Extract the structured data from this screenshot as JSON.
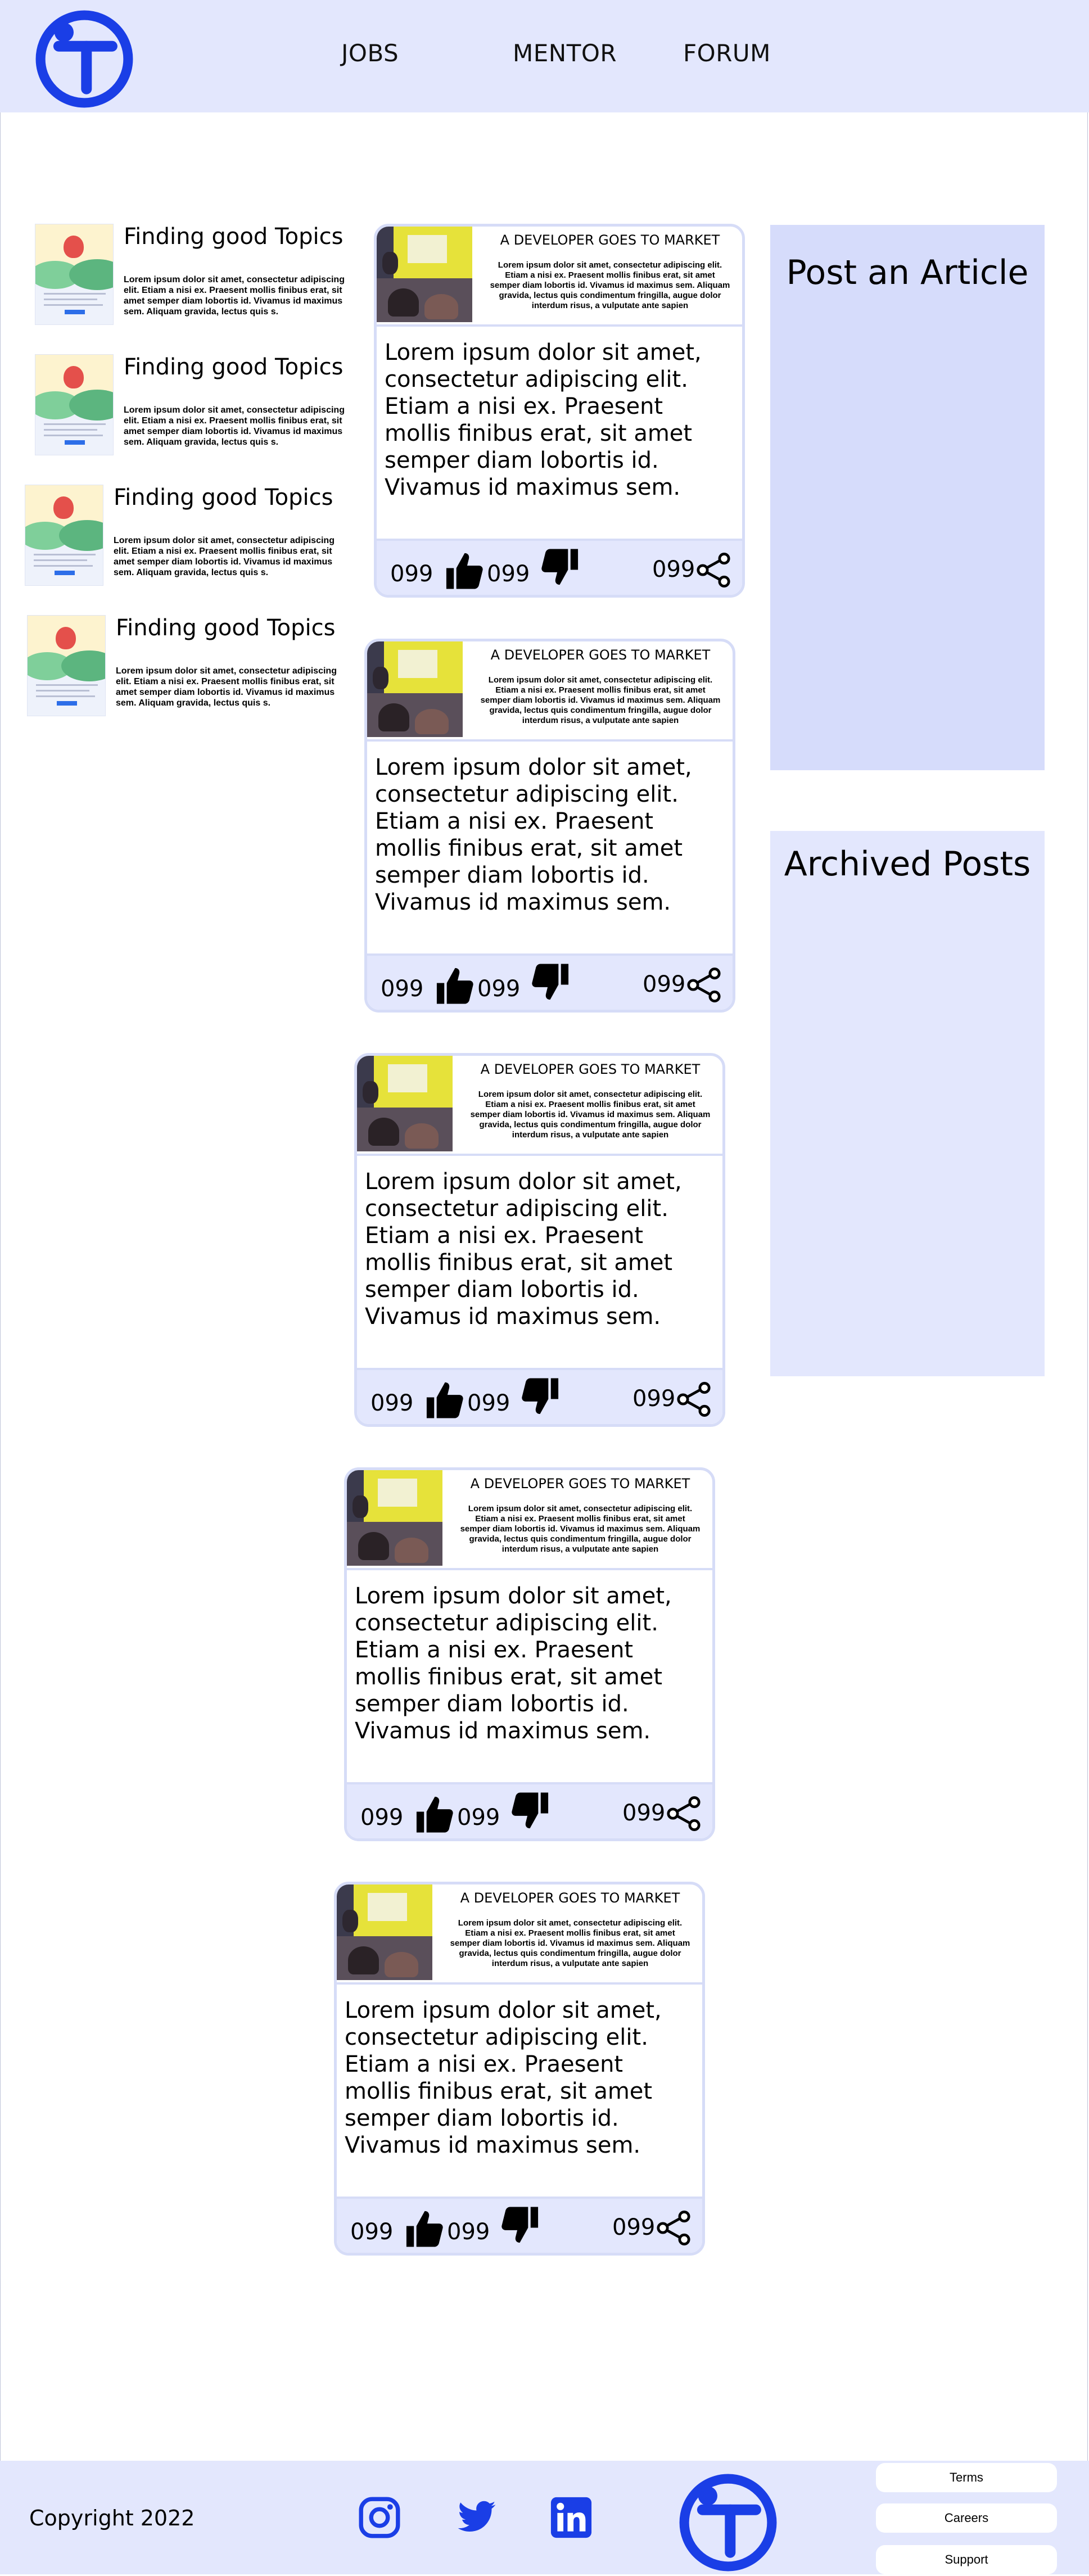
{
  "header": {
    "logo": "logo-t-icon",
    "nav": [
      "JOBS",
      "MENTOR",
      "FORUM"
    ]
  },
  "sidebar": {
    "topics": [
      {
        "title": "Finding good Topics",
        "desc": "Lorem ipsum dolor sit amet, consectetur adipiscing elit. Etiam a nisi ex. Praesent mollis finibus erat, sit amet semper diam lobortis id. Vivamus id maximus sem. Aliquam gravida, lectus quis s."
      },
      {
        "title": "Finding good Topics",
        "desc": "Lorem ipsum dolor sit amet, consectetur adipiscing elit. Etiam a nisi ex. Praesent mollis finibus erat, sit amet semper diam lobortis id. Vivamus id maximus sem. Aliquam gravida, lectus quis s."
      },
      {
        "title": "Finding good Topics",
        "desc": "Lorem ipsum dolor sit amet, consectetur adipiscing elit. Etiam a nisi ex. Praesent mollis finibus erat, sit amet semper diam lobortis id. Vivamus id maximus sem. Aliquam gravida, lectus quis s."
      },
      {
        "title": "Finding good Topics",
        "desc": "Lorem ipsum dolor sit amet, consectetur adipiscing elit. Etiam a nisi ex. Praesent mollis finibus erat, sit amet semper diam lobortis id. Vivamus id maximus sem. Aliquam gravida, lectus quis s."
      }
    ]
  },
  "articles": [
    {
      "headline": "A DEVELOPER GOES TO MARKET",
      "summary": "Lorem ipsum dolor sit amet, consectetur adipiscing elit. Etiam a nisi ex. Praesent mollis finibus erat, sit amet semper diam lobortis id. Vivamus id maximus sem. Aliquam gravida, lectus quis condimentum fringilla, augue dolor interdum risus, a vulputate ante sapien",
      "body": "Lorem ipsum dolor sit amet, consectetur adipiscing elit. Etiam a nisi ex. Praesent mollis finibus erat, sit amet semper diam lobortis id. Vivamus id maximus sem.",
      "likes": "099",
      "dislikes": "099",
      "shares": "099"
    },
    {
      "headline": "A DEVELOPER GOES TO MARKET",
      "summary": "Lorem ipsum dolor sit amet, consectetur adipiscing elit. Etiam a nisi ex. Praesent mollis finibus erat, sit amet semper diam lobortis id. Vivamus id maximus sem. Aliquam gravida, lectus quis condimentum fringilla, augue dolor interdum risus, a vulputate ante sapien",
      "body": "Lorem ipsum dolor sit amet, consectetur adipiscing elit. Etiam a nisi ex. Praesent mollis finibus erat, sit amet semper diam lobortis id. Vivamus id maximus sem.",
      "likes": "099",
      "dislikes": "099",
      "shares": "099"
    },
    {
      "headline": "A DEVELOPER GOES TO MARKET",
      "summary": "Lorem ipsum dolor sit amet, consectetur adipiscing elit. Etiam a nisi ex. Praesent mollis finibus erat, sit amet semper diam lobortis id. Vivamus id maximus sem. Aliquam gravida, lectus quis condimentum fringilla, augue dolor interdum risus, a vulputate ante sapien",
      "body": "Lorem ipsum dolor sit amet, consectetur adipiscing elit. Etiam a nisi ex. Praesent mollis finibus erat, sit amet semper diam lobortis id. Vivamus id maximus sem.",
      "likes": "099",
      "dislikes": "099",
      "shares": "099"
    },
    {
      "headline": "A DEVELOPER GOES TO MARKET",
      "summary": "Lorem ipsum dolor sit amet, consectetur adipiscing elit. Etiam a nisi ex. Praesent mollis finibus erat, sit amet semper diam lobortis id. Vivamus id maximus sem. Aliquam gravida, lectus quis condimentum fringilla, augue dolor interdum risus, a vulputate ante sapien",
      "body": "Lorem ipsum dolor sit amet, consectetur adipiscing elit. Etiam a nisi ex. Praesent mollis finibus erat, sit amet semper diam lobortis id. Vivamus id maximus sem.",
      "likes": "099",
      "dislikes": "099",
      "shares": "099"
    },
    {
      "headline": "A DEVELOPER GOES TO MARKET",
      "summary": "Lorem ipsum dolor sit amet, consectetur adipiscing elit. Etiam a nisi ex. Praesent mollis finibus erat, sit amet semper diam lobortis id. Vivamus id maximus sem. Aliquam gravida, lectus quis condimentum fringilla, augue dolor interdum risus, a vulputate ante sapien",
      "body": "Lorem ipsum dolor sit amet, consectetur adipiscing elit. Etiam a nisi ex. Praesent mollis finibus erat, sit amet semper diam lobortis id. Vivamus id maximus sem.",
      "likes": "099",
      "dislikes": "099",
      "shares": "099"
    }
  ],
  "panels": {
    "post_title": "Post an Article",
    "archived_title": "Archived Posts"
  },
  "footer": {
    "copyright": "Copyright 2022",
    "social_icons": [
      "instagram-icon",
      "twitter-icon",
      "linkedin-icon"
    ],
    "links": [
      "Terms",
      "Careers",
      "Support"
    ]
  },
  "colors": {
    "accent": "#1a3ee6",
    "header_bg": "#e3e7fd",
    "panel_bg": "#d6dcfb",
    "card_border": "#d6dcf7"
  }
}
